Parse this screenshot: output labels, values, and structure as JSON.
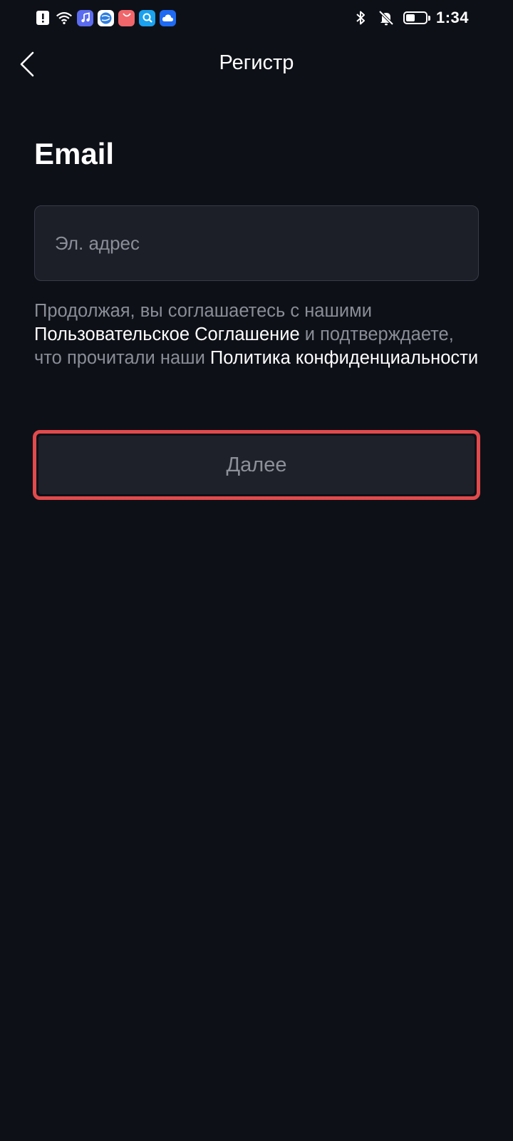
{
  "status_bar": {
    "time": "1:34",
    "left_icons": [
      "alert-icon",
      "wifi-icon",
      "music-app-icon",
      "browser-app-icon",
      "shopping-app-icon",
      "search-app-icon",
      "cloud-app-icon"
    ],
    "right_icons": [
      "bluetooth-icon",
      "notifications-off-icon",
      "battery-icon"
    ],
    "battery_level": 0.45
  },
  "header": {
    "title": "Регистр",
    "back_icon": "chevron-left-icon"
  },
  "form": {
    "heading": "Email",
    "email_placeholder": "Эл. адрес",
    "email_value": ""
  },
  "terms": {
    "text_1": "Продолжая, вы соглашаетесь с нашими ",
    "user_agreement_link": "Пользовательское Соглашение",
    "text_2": " и подтверждаете, что прочитали наши ",
    "privacy_policy_link": "Политика конфиденциальности"
  },
  "next_button": {
    "label": "Далее"
  },
  "colors": {
    "background": "#0e1018",
    "input_background": "#1d1f28",
    "highlight_border": "#e24a4c",
    "muted_text": "#8a8d96"
  }
}
